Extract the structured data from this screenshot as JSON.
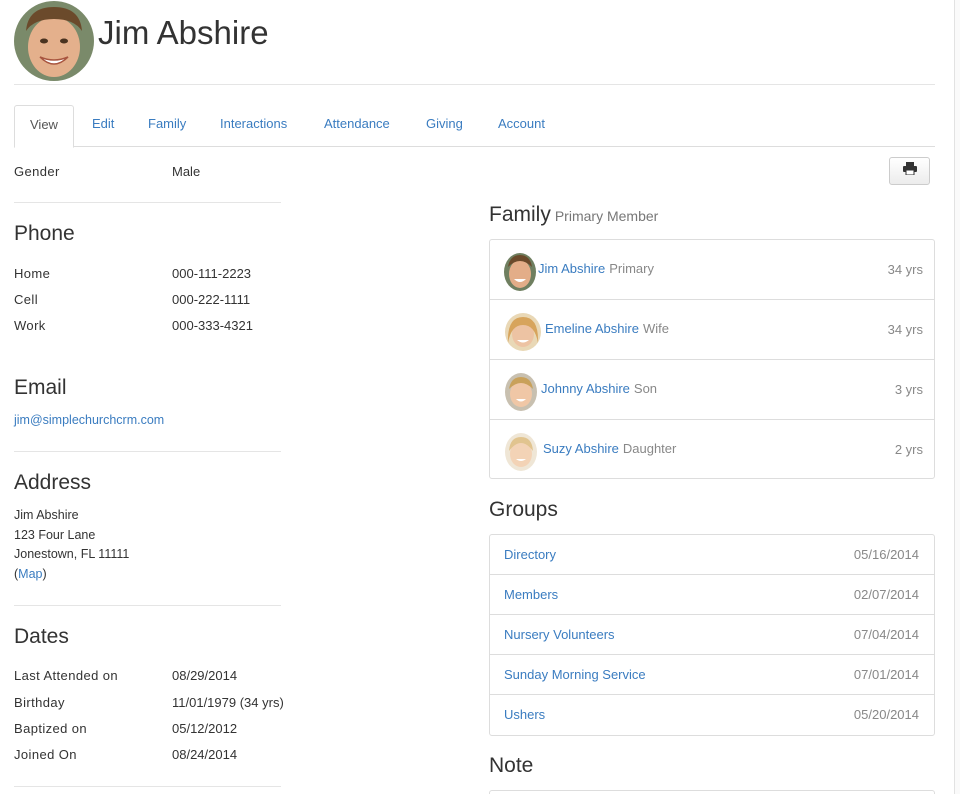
{
  "person": {
    "name": "Jim Abshire"
  },
  "tabs": [
    {
      "label": "View"
    },
    {
      "label": "Edit"
    },
    {
      "label": "Family"
    },
    {
      "label": "Interactions"
    },
    {
      "label": "Attendance"
    },
    {
      "label": "Giving"
    },
    {
      "label": "Account"
    }
  ],
  "gender": {
    "label": "Gender",
    "value": "Male"
  },
  "phone": {
    "title": "Phone",
    "rows": [
      {
        "label": "Home",
        "value": "000-111-2223"
      },
      {
        "label": "Cell",
        "value": "000-222-1111"
      },
      {
        "label": "Work",
        "value": "000-333-4321"
      }
    ]
  },
  "email": {
    "title": "Email",
    "value": "jim@simplechurchcrm.com"
  },
  "address": {
    "title": "Address",
    "line1": "Jim Abshire",
    "line2": "123 Four Lane",
    "line3": "Jonestown, FL 11111",
    "map_open": "(",
    "map_label": "Map",
    "map_close": ")"
  },
  "dates": {
    "title": "Dates",
    "rows": [
      {
        "label": "Last Attended on",
        "value": "08/29/2014"
      },
      {
        "label": "Birthday",
        "value": "11/01/1979 (34 yrs)"
      },
      {
        "label": "Baptized on",
        "value": "05/12/2012"
      },
      {
        "label": "Joined On",
        "value": "08/24/2014"
      }
    ]
  },
  "print": {
    "icon": "printer-icon"
  },
  "family": {
    "title": "Family",
    "subtitle": "Primary Member",
    "members": [
      {
        "name": "Jim Abshire",
        "role": "Primary",
        "age": "34 yrs"
      },
      {
        "name": "Emeline Abshire",
        "role": "Wife",
        "age": "34 yrs"
      },
      {
        "name": "Johnny Abshire",
        "role": "Son",
        "age": "3 yrs"
      },
      {
        "name": "Suzy Abshire",
        "role": "Daughter",
        "age": "2 yrs"
      }
    ]
  },
  "groups": {
    "title": "Groups",
    "items": [
      {
        "name": "Directory",
        "date": "05/16/2014"
      },
      {
        "name": "Members",
        "date": "02/07/2014"
      },
      {
        "name": "Nursery Volunteers",
        "date": "07/04/2014"
      },
      {
        "name": "Sunday Morning Service",
        "date": "07/01/2014"
      },
      {
        "name": "Ushers",
        "date": "05/20/2014"
      }
    ]
  },
  "note": {
    "title": "Note"
  },
  "colors": {
    "link": "#3a7cc0",
    "muted": "#888888",
    "border": "#dddddd"
  }
}
